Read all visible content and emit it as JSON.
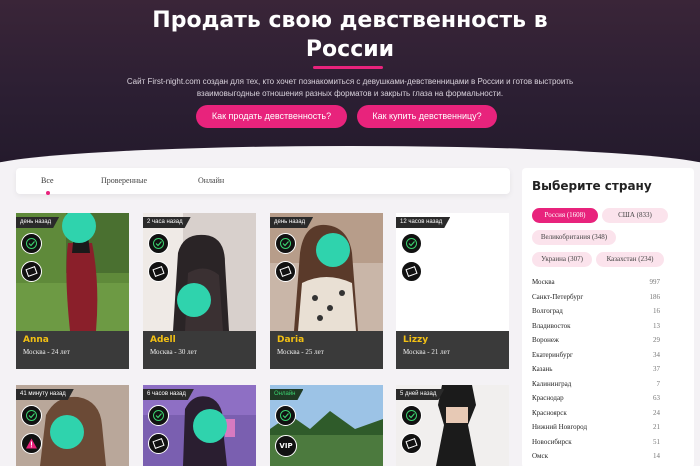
{
  "hero": {
    "title": "Продать свою девственность в России",
    "description": "Сайт First-night.com создан для тех, кто хочет познакомиться с девушками-девственницами в России и готов выстроить взаимовыгодные отношения разных форматов и закрыть глаза на формальности.",
    "sell_button": "Как продать девственность?",
    "buy_button": "Как купить девственницу?"
  },
  "tabs": {
    "all": "Все",
    "verified": "Проверенные",
    "online": "Онлайн"
  },
  "cards": [
    {
      "time": "день назад",
      "name": "Anna",
      "sub": "Москва - 24 лет"
    },
    {
      "time": "2 часа назад",
      "name": "Adell",
      "sub": "Москва - 30 лет"
    },
    {
      "time": "день назад",
      "name": "Daria",
      "sub": "Москва - 25 лет"
    },
    {
      "time": "12 часов назад",
      "name": "Lizzy",
      "sub": "Москва - 21 лет"
    },
    {
      "time": "41 минуту назад"
    },
    {
      "time": "6 часов назад"
    },
    {
      "time": "Онлайн",
      "badge": "VIP"
    },
    {
      "time": "5 дней назад"
    }
  ],
  "sidebar": {
    "title": "Выберите страну",
    "countries": [
      {
        "label": "Россия (1608)",
        "active": true
      },
      {
        "label": "США (833)"
      },
      {
        "label": "Великобритания (348)"
      },
      {
        "label": "Украина (307)"
      },
      {
        "label": "Казахстан (234)"
      }
    ],
    "cities": [
      {
        "name": "Москва",
        "count": "997"
      },
      {
        "name": "Санкт-Петербург",
        "count": "186"
      },
      {
        "name": "Волгоград",
        "count": "16"
      },
      {
        "name": "Владивосток",
        "count": "13"
      },
      {
        "name": "Воронеж",
        "count": "29"
      },
      {
        "name": "Екатеринбург",
        "count": "34"
      },
      {
        "name": "Казань",
        "count": "37"
      },
      {
        "name": "Калининград",
        "count": "7"
      },
      {
        "name": "Краснодар",
        "count": "63"
      },
      {
        "name": "Красноярск",
        "count": "24"
      },
      {
        "name": "Нижний Новгород",
        "count": "21"
      },
      {
        "name": "Новосибирск",
        "count": "51"
      },
      {
        "name": "Омск",
        "count": "14"
      }
    ]
  },
  "colors": {
    "accent": "#e8237c",
    "name_yellow": "#f2c014",
    "hero_bg": "#2c1f33",
    "face_blur": "#2fd3ad"
  }
}
